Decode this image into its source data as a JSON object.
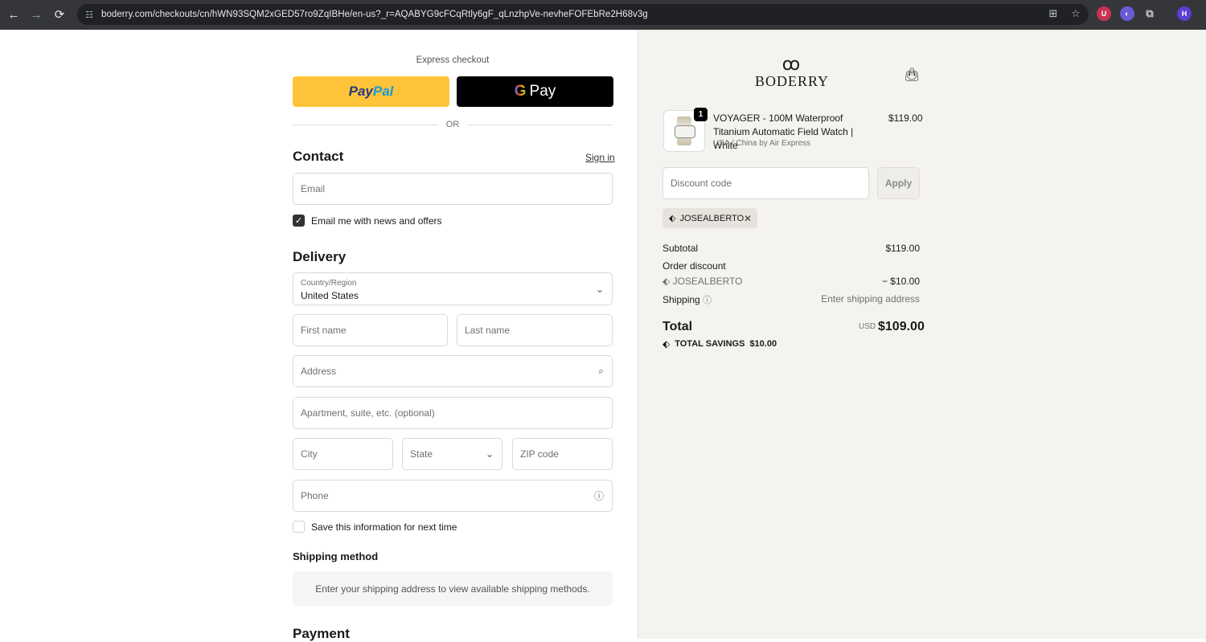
{
  "browser": {
    "url": "boderry.com/checkouts/cn/hWN93SQM2xGED57ro9ZqIBHe/en-us?_r=AQABYG9cFCqRtly6gF_qLnzhpVe-nevheFOFEbRe2H68v3g",
    "profile_initial": "H",
    "icons": [
      "back-icon",
      "forward-icon",
      "reload-icon",
      "site-info-icon",
      "translate-icon",
      "star-icon",
      "extension-icon",
      "profile-icon"
    ]
  },
  "express": {
    "label": "Express checkout",
    "paypal_a": "Pay",
    "paypal_b": "Pal",
    "gpay_g": "G",
    "gpay_text": "Pay",
    "or": "OR"
  },
  "contact": {
    "heading": "Contact",
    "signin": "Sign in",
    "email_placeholder": "Email",
    "newsletter_label": "Email me with news and offers",
    "newsletter_checked": true
  },
  "delivery": {
    "heading": "Delivery",
    "country_label": "Country/Region",
    "country_value": "United States",
    "first_name": "First name",
    "last_name": "Last name",
    "address": "Address",
    "apartment": "Apartment, suite, etc. (optional)",
    "city": "City",
    "state": "State",
    "zip": "ZIP code",
    "phone": "Phone",
    "save_info_label": "Save this information for next time",
    "save_info_checked": false
  },
  "shipping_method": {
    "heading": "Shipping method",
    "message": "Enter your shipping address to view available shipping methods."
  },
  "payment": {
    "heading": "Payment"
  },
  "summary": {
    "brand": "BODERRY",
    "item": {
      "quantity": "1",
      "title": "VOYAGER - 100M Waterproof Titanium Automatic Field Watch | White",
      "variant": "USA / China by Air Express",
      "price": "$119.00"
    },
    "discount_placeholder": "Discount code",
    "apply": "Apply",
    "applied_code": "JOSEALBERTO",
    "subtotal_label": "Subtotal",
    "subtotal": "$119.00",
    "order_discount_label": "Order discount",
    "discount_code": "JOSEALBERTO",
    "discount_amount": "− $10.00",
    "shipping_label": "Shipping",
    "shipping_value": "Enter shipping address",
    "total_label": "Total",
    "currency": "USD",
    "total": "$109.00",
    "savings_label": "TOTAL SAVINGS",
    "savings": "$10.00"
  }
}
